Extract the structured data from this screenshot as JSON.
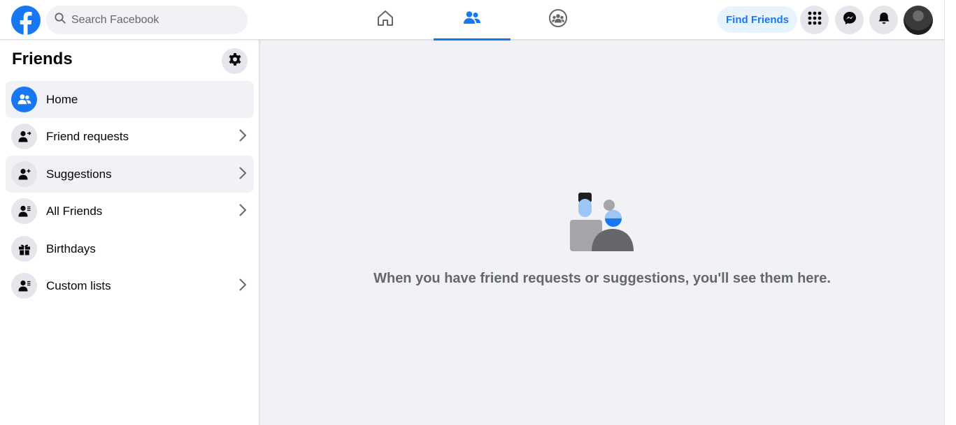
{
  "header": {
    "search_placeholder": "Search Facebook",
    "find_friends_label": "Find Friends",
    "nav_tabs": [
      "home-icon",
      "friends-icon",
      "groups-icon"
    ],
    "active_tab": "friends-icon"
  },
  "sidebar": {
    "title": "Friends",
    "items": [
      {
        "label": "Home",
        "icon": "friends-icon",
        "selected": true
      },
      {
        "label": "Friend requests",
        "icon": "person-arrow-icon",
        "chevron": true
      },
      {
        "label": "Suggestions",
        "icon": "person-add-icon",
        "chevron": true
      },
      {
        "label": "All Friends",
        "icon": "person-list-icon",
        "chevron": true
      },
      {
        "label": "Birthdays",
        "icon": "gift-icon"
      },
      {
        "label": "Custom lists",
        "icon": "person-list-icon",
        "chevron": true
      }
    ]
  },
  "main": {
    "empty_message": "When you have friend requests or suggestions, you'll see them here."
  },
  "colors": {
    "accent": "#1877f2",
    "background": "#f0f2f5",
    "muted_text": "#65676b"
  }
}
